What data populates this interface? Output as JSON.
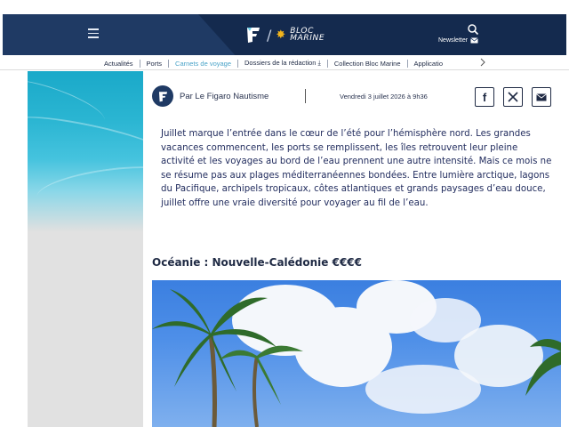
{
  "header": {
    "menu_icon": "hamburger-menu-icon",
    "brand_primary": "F",
    "brand_secondary_line1": "BLOC",
    "brand_secondary_line2": "MARINE",
    "search_icon": "search-icon",
    "newsletter_label": "Newsletter",
    "newsletter_icon": "envelope-icon",
    "colors": {
      "bar": "#1f3a64",
      "bar_dark": "#142a4e",
      "accent": "#f2b51c"
    }
  },
  "nav": {
    "items": [
      {
        "label": "Actualités",
        "active": false
      },
      {
        "label": "Ports",
        "active": false
      },
      {
        "label": "Carnets de voyage",
        "active": true
      },
      {
        "label": "Dossiers de la rédaction ⤓",
        "active": false
      },
      {
        "label": "Collection Bloc Marine",
        "active": false
      },
      {
        "label": "Applicatio",
        "active": false
      }
    ],
    "more_icon": "chevron-right-icon",
    "active_color": "#4aa3c8"
  },
  "article": {
    "author": "Par Le Figaro Nautisme",
    "date": "Vendredi 3 juillet 2026 à 9h36",
    "share": [
      {
        "name": "facebook-share-icon",
        "glyph": "f"
      },
      {
        "name": "x-share-icon",
        "glyph": "𝕏"
      },
      {
        "name": "email-share-icon",
        "glyph": "✉"
      }
    ],
    "intro": "Juillet marque l’entrée dans le cœur de l’été pour l’hémisphère nord. Les grandes vacances commencent, les ports se remplissent, les îles retrouvent leur pleine activité et les voyages au bord de l’eau prennent une autre intensité. Mais ce mois ne se résume pas aux plages méditerranéennes bondées. Entre lumière arctique, lagons du Pacifique, archipels tropicaux, côtes atlantiques et grands paysages d’eau douce, juillet offre une vraie diversité pour voyager au fil de l’eau.",
    "section_title": "Océanie : Nouvelle-Calédonie €€€€",
    "text_color": "#1f2a5c"
  }
}
